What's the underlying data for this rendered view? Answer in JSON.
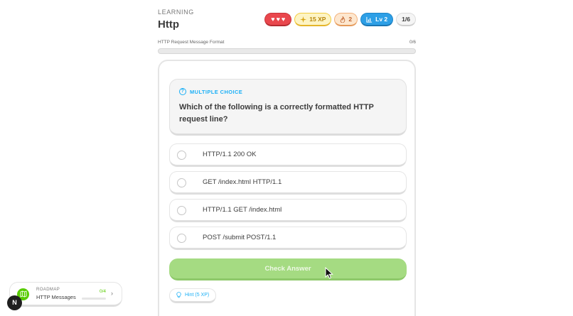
{
  "header": {
    "eyebrow": "LEARNING",
    "title": "Http"
  },
  "badges": {
    "hearts": 3,
    "hearts_glyph": "♥",
    "xp_icon": "sparkle-icon",
    "xp": "15 XP",
    "streak_icon": "flame-icon",
    "streak": "2",
    "level_icon": "chart-icon",
    "level": "Lv 2",
    "progress": "1/6"
  },
  "lesson_progress": {
    "label": "HTTP Request Message Format",
    "count": "0/6",
    "fraction": 0
  },
  "question": {
    "type_label": "MULTIPLE CHOICE",
    "type_icon": "question-icon",
    "text": "Which of the following is a correctly formatted HTTP request line?"
  },
  "options": [
    {
      "label": "HTTP/1.1 200 OK"
    },
    {
      "label": "GET /index.html HTTP/1.1"
    },
    {
      "label": "HTTP/1.1 GET /index.html"
    },
    {
      "label": "POST /submit POST/1.1"
    }
  ],
  "actions": {
    "check_label": "Check Answer",
    "hint_label": "Hint (5 XP)",
    "hint_icon": "lightbulb-icon"
  },
  "roadmap": {
    "eyebrow": "ROADMAP",
    "title": "HTTP Messages",
    "count": "0/4",
    "fraction": 0,
    "icon": "map-icon",
    "chevron": "›"
  },
  "logo": {
    "letter": "N"
  },
  "colors": {
    "accent_blue": "#1cb0f6",
    "accent_green": "#58cc02",
    "check_disabled": "#a5db82",
    "hearts_red": "#e9474d"
  }
}
